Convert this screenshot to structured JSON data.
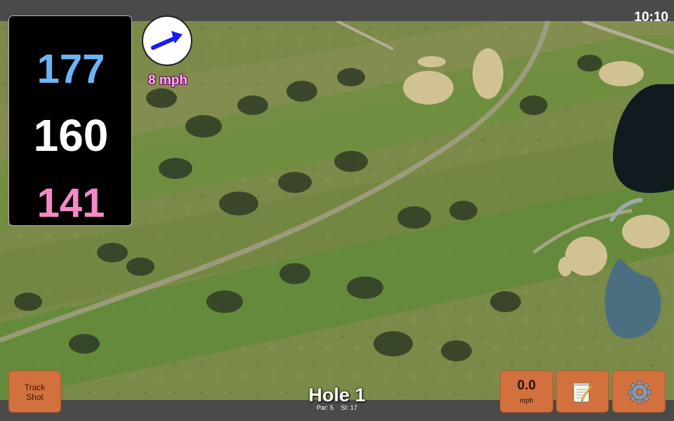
{
  "status": {
    "time": "10:10"
  },
  "distances": {
    "back": "177",
    "middle": "160",
    "front": "141"
  },
  "wind": {
    "speed": "8 mph",
    "direction_icon": "wind-arrow-icon"
  },
  "hole": {
    "title": "Hole 1",
    "par": "Par: 5",
    "stroke_index": "SI: 17"
  },
  "buttons": {
    "track_shot_line1": "Track",
    "track_shot_line2": "Shot",
    "speed_value": "0.0",
    "speed_unit": "mph",
    "notes_icon": "notepad-icon",
    "settings_icon": "gear-icon"
  },
  "colors": {
    "back_distance": "#6cb4f5",
    "middle_distance": "#ffffff",
    "front_distance": "#f48ac5",
    "button_bg": "#d2703e",
    "wind_arrow": "#1a1aff"
  }
}
